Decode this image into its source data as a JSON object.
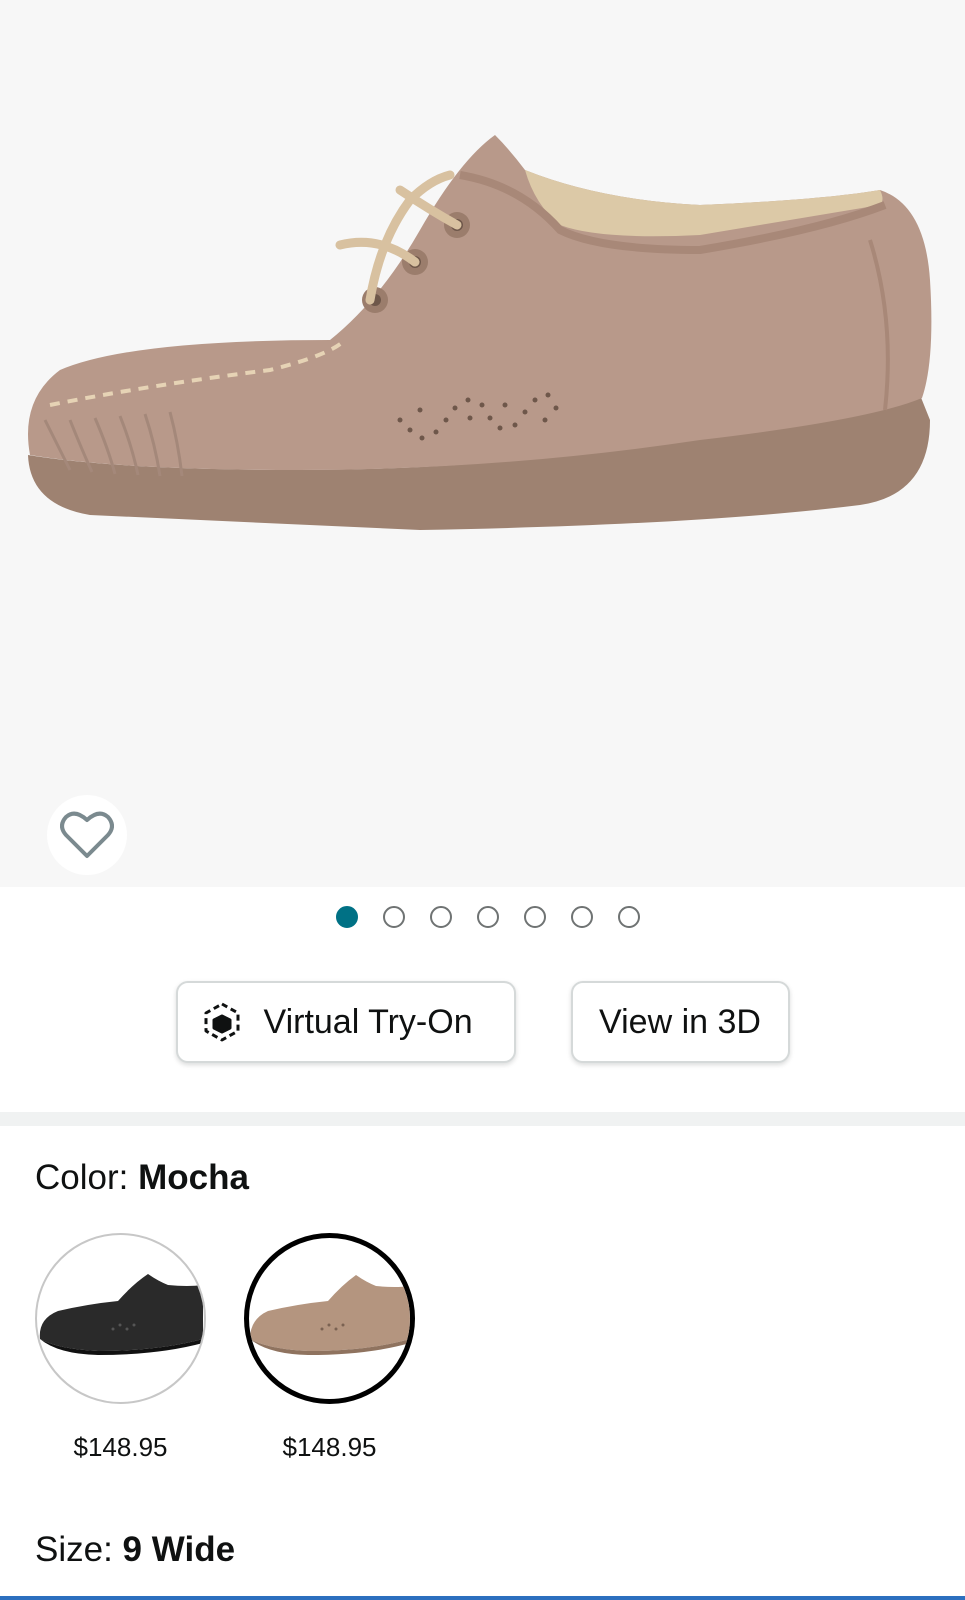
{
  "gallery": {
    "image_icon": "shoe-product-image",
    "favorite_icon": "heart-icon",
    "dots": [
      {
        "active": true
      },
      {
        "active": false
      },
      {
        "active": false
      },
      {
        "active": false
      },
      {
        "active": false
      },
      {
        "active": false
      },
      {
        "active": false
      }
    ]
  },
  "actions": {
    "tryon_label": "Virtual Try-On",
    "tryon_icon": "cube-icon",
    "view3d_label": "View in 3D"
  },
  "color": {
    "label": "Color: ",
    "value": "Mocha",
    "options": [
      {
        "name": "black",
        "price": "$148.95",
        "selected": false,
        "swatch_color": "#2a2a2a"
      },
      {
        "name": "mocha",
        "price": "$148.95",
        "selected": true,
        "swatch_color": "#b4957f"
      }
    ]
  },
  "size": {
    "label": "Size: ",
    "value": "9 Wide"
  },
  "colors": {
    "accent": "#007185",
    "text": "#0f1111",
    "hero_bg": "#f7f7f7",
    "shoe": "#b8998a",
    "sole": "#9a7f6d"
  }
}
